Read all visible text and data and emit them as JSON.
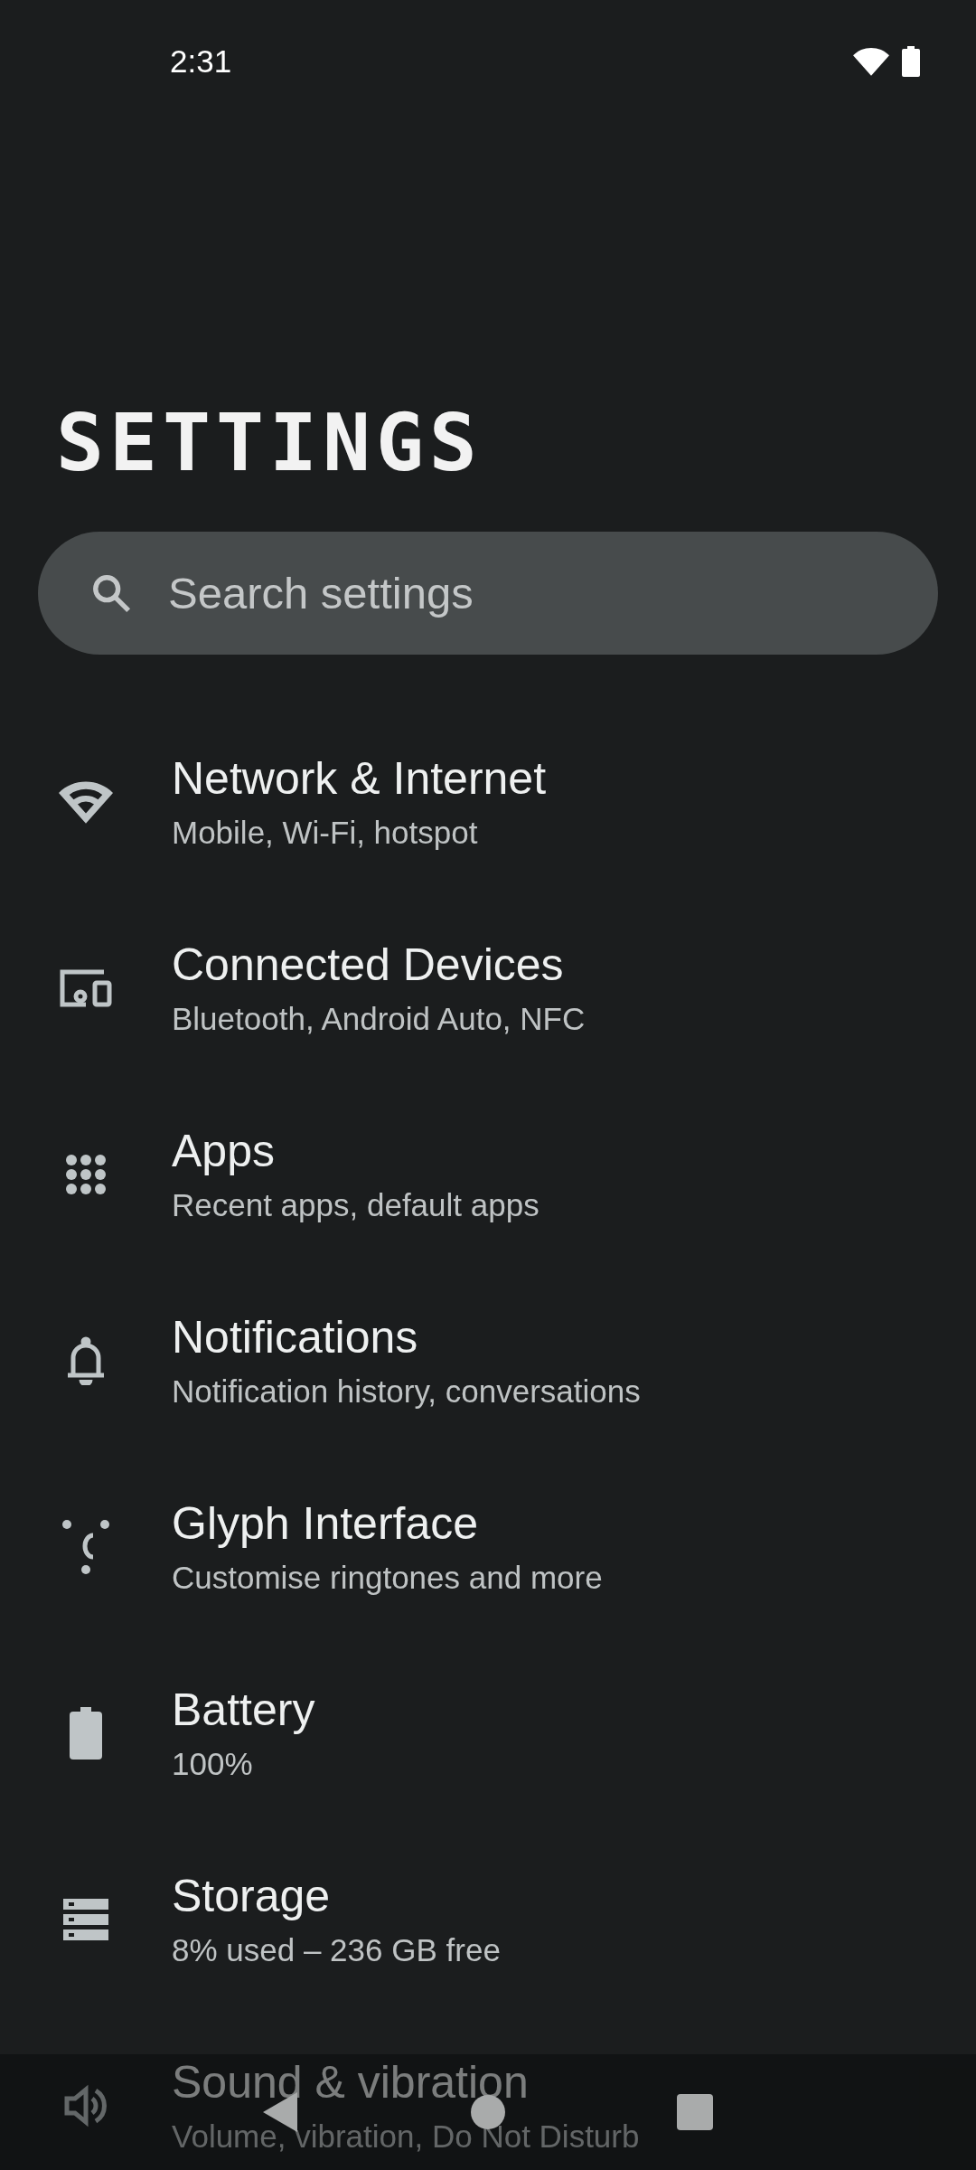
{
  "status_bar": {
    "time": "2:31"
  },
  "title": "SETTINGS",
  "search": {
    "placeholder": "Search settings"
  },
  "items": [
    {
      "title": "Network & Internet",
      "subtitle": "Mobile, Wi-Fi, hotspot"
    },
    {
      "title": "Connected Devices",
      "subtitle": "Bluetooth, Android Auto, NFC"
    },
    {
      "title": "Apps",
      "subtitle": "Recent apps, default apps"
    },
    {
      "title": "Notifications",
      "subtitle": "Notification history, conversations"
    },
    {
      "title": "Glyph Interface",
      "subtitle": "Customise ringtones and more"
    },
    {
      "title": "Battery",
      "subtitle": "100%"
    },
    {
      "title": "Storage",
      "subtitle": "8% used – 236 GB free"
    },
    {
      "title": "Sound & vibration",
      "subtitle": "Volume, vibration, Do Not Disturb"
    }
  ]
}
